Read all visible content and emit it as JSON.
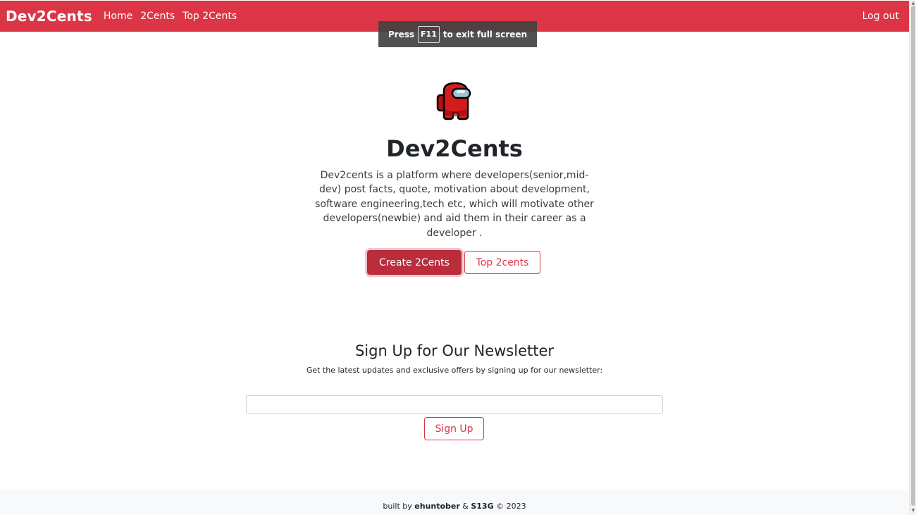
{
  "navbar": {
    "brand": "Dev2Cents",
    "links": [
      {
        "label": "Home"
      },
      {
        "label": "2Cents"
      },
      {
        "label": "Top 2Cents"
      }
    ],
    "logout": "Log out"
  },
  "fullscreen_toast": {
    "prefix": "Press",
    "key": "F11",
    "suffix": "to exit full screen"
  },
  "hero": {
    "icon": "red-crewmate-icon",
    "title": "Dev2Cents",
    "description": "Dev2cents is a platform where developers(senior,mid-dev) post facts, quote, motivation about development, software engineering,tech etc, which will motivate other developers(newbie) and aid them in their career as a developer .",
    "create_button": "Create 2Cents",
    "top_button": "Top 2cents"
  },
  "newsletter": {
    "title": "Sign Up for Our Newsletter",
    "subtitle": "Get the latest updates and exclusive offers by signing up for our newsletter:",
    "email_value": "",
    "signup_button": "Sign Up"
  },
  "footer": {
    "prefix": "built by",
    "author1": "ehuntober",
    "separator": "&",
    "author2": "S13G",
    "copyright": "© 2023"
  },
  "colors": {
    "primary": "#dc3545",
    "primary_dark": "#bb2d3b",
    "footer_bg": "#f8f9fa"
  }
}
